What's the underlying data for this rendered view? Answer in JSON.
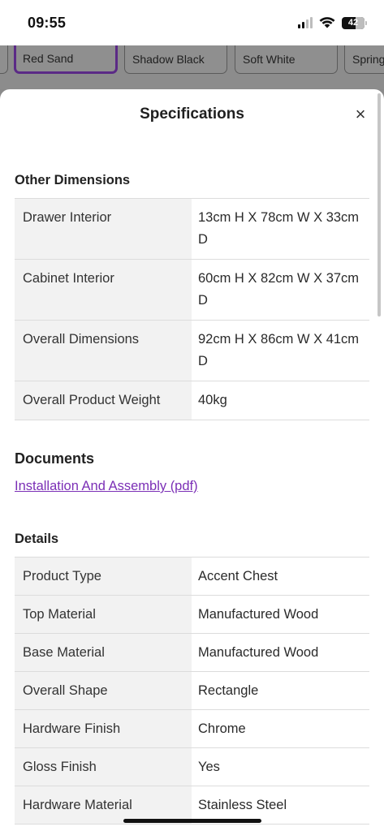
{
  "status_bar": {
    "time": "09:55",
    "battery_level": "42"
  },
  "color_options": [
    {
      "label": "Red Sand",
      "selected": true
    },
    {
      "label": "Shadow Black",
      "selected": false
    },
    {
      "label": "Soft White",
      "selected": false
    },
    {
      "label": "Spring",
      "selected": false
    }
  ],
  "sheet": {
    "title": "Specifications",
    "close_symbol": "×"
  },
  "other_dimensions": {
    "heading": "Other Dimensions",
    "rows": [
      {
        "key": "Drawer Interior",
        "value": "13cm H X 78cm W X 33cm D"
      },
      {
        "key": "Cabinet Interior",
        "value": "60cm H X 82cm W X 37cm D"
      },
      {
        "key": "Overall Dimensions",
        "value": "92cm H X 86cm W X 41cm D"
      },
      {
        "key": "Overall Product Weight",
        "value": "40kg"
      }
    ]
  },
  "documents": {
    "heading": "Documents",
    "link_label": "Installation And Assembly (pdf)"
  },
  "details": {
    "heading": "Details",
    "rows": [
      {
        "key": "Product Type",
        "value": "Accent Chest"
      },
      {
        "key": "Top Material",
        "value": "Manufactured Wood"
      },
      {
        "key": "Base Material",
        "value": "Manufactured Wood"
      },
      {
        "key": "Overall Shape",
        "value": "Rectangle"
      },
      {
        "key": "Hardware Finish",
        "value": "Chrome"
      },
      {
        "key": "Gloss Finish",
        "value": "Yes"
      },
      {
        "key": "Hardware Material",
        "value": "Stainless Steel"
      }
    ]
  },
  "colors": {
    "accent": "#5b2a86",
    "link": "#7b2fb6",
    "key_cell_bg": "#f2f2f2",
    "overlay": "#8a8a8a"
  }
}
